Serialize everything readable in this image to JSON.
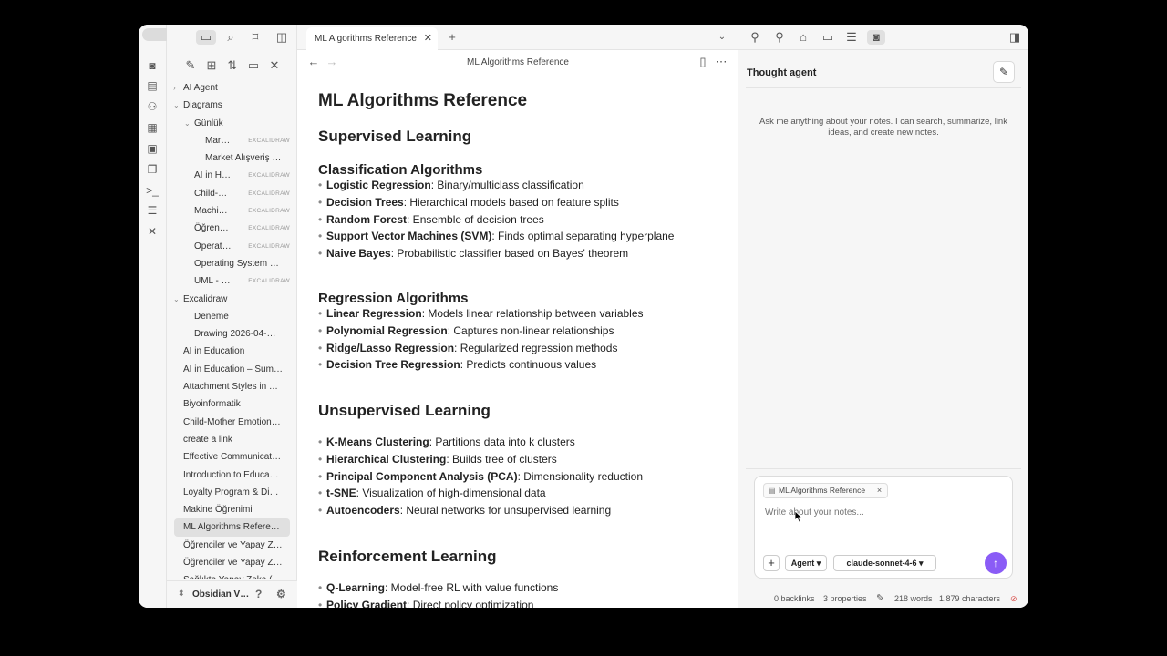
{
  "sidebar": {
    "tree": [
      {
        "label": "AI Agent",
        "level": 0,
        "chevron": "right"
      },
      {
        "label": "Diagrams",
        "level": 0,
        "chevron": "down"
      },
      {
        "label": "Günlük",
        "level": 1,
        "chevron": "down"
      },
      {
        "label": "Mar…",
        "level": 2,
        "tag": "EXCALIDRAW"
      },
      {
        "label": "Market Alışveriş …",
        "level": 2
      },
      {
        "label": "AI in H…",
        "level": 1,
        "tag": "EXCALIDRAW"
      },
      {
        "label": "Child-…",
        "level": 1,
        "tag": "EXCALIDRAW"
      },
      {
        "label": "Machi…",
        "level": 1,
        "tag": "EXCALIDRAW"
      },
      {
        "label": "Öğren…",
        "level": 1,
        "tag": "EXCALIDRAW"
      },
      {
        "label": "Operat…",
        "level": 1,
        "tag": "EXCALIDRAW"
      },
      {
        "label": "Operating System …",
        "level": 1
      },
      {
        "label": "UML - …",
        "level": 1,
        "tag": "EXCALIDRAW"
      },
      {
        "label": "Excalidraw",
        "level": 0,
        "chevron": "down"
      },
      {
        "label": "Deneme",
        "level": 1
      },
      {
        "label": "Drawing 2026-04-…",
        "level": 1
      },
      {
        "label": "AI in Education",
        "level": 0
      },
      {
        "label": "AI in Education – Sum…",
        "level": 0
      },
      {
        "label": "Attachment Styles in …",
        "level": 0
      },
      {
        "label": "Biyoinformatik",
        "level": 0
      },
      {
        "label": "Child-Mother Emotion…",
        "level": 0
      },
      {
        "label": "create a link",
        "level": 0
      },
      {
        "label": "Effective Communicat…",
        "level": 0
      },
      {
        "label": "Introduction to Educa…",
        "level": 0
      },
      {
        "label": "Loyalty Program & Di…",
        "level": 0
      },
      {
        "label": "Makine Öğrenimi",
        "level": 0
      },
      {
        "label": "ML Algorithms Refere…",
        "level": 0,
        "active": true
      },
      {
        "label": "Öğrenciler ve Yapay Z…",
        "level": 0
      },
      {
        "label": "Öğrenciler ve Yapay Z…",
        "level": 0
      },
      {
        "label": "Sağlıkta Yapay Zeka (…",
        "level": 0
      }
    ],
    "vault_name": "Obsidian V…"
  },
  "editor": {
    "tab_title": "ML Algorithms Reference",
    "nav_title": "ML Algorithms Reference",
    "doc": {
      "title": "ML Algorithms Reference",
      "s1": "Supervised Learning",
      "s1a": "Classification Algorithms",
      "s1a_items": [
        {
          "term": "Logistic Regression",
          "desc": ": Binary/multiclass classification"
        },
        {
          "term": "Decision Trees",
          "desc": ": Hierarchical models based on feature splits"
        },
        {
          "term": "Random Forest",
          "desc": ": Ensemble of decision trees"
        },
        {
          "term": "Support Vector Machines (SVM)",
          "desc": ": Finds optimal separating hyperplane"
        },
        {
          "term": "Naive Bayes",
          "desc": ": Probabilistic classifier based on Bayes' theorem"
        }
      ],
      "s1b": "Regression Algorithms",
      "s1b_items": [
        {
          "term": "Linear Regression",
          "desc": ": Models linear relationship between variables"
        },
        {
          "term": "Polynomial Regression",
          "desc": ": Captures non-linear relationships"
        },
        {
          "term": "Ridge/Lasso Regression",
          "desc": ": Regularized regression methods"
        },
        {
          "term": "Decision Tree Regression",
          "desc": ": Predicts continuous values"
        }
      ],
      "s2": "Unsupervised Learning",
      "s2_items": [
        {
          "term": "K-Means Clustering",
          "desc": ": Partitions data into k clusters"
        },
        {
          "term": "Hierarchical Clustering",
          "desc": ": Builds tree of clusters"
        },
        {
          "term": "Principal Component Analysis (PCA)",
          "desc": ": Dimensionality reduction"
        },
        {
          "term": "t-SNE",
          "desc": ": Visualization of high-dimensional data"
        },
        {
          "term": "Autoencoders",
          "desc": ": Neural networks for unsupervised learning"
        }
      ],
      "s3": "Reinforcement Learning",
      "s3_items": [
        {
          "term": "Q-Learning",
          "desc": ": Model-free RL with value functions"
        },
        {
          "term": "Policy Gradient",
          "desc": ": Direct policy optimization"
        }
      ]
    }
  },
  "agent": {
    "title": "Thought agent",
    "hint": "Ask me anything about your notes. I can search, summarize, link ideas, and create new notes.",
    "context_chip": "ML Algorithms Reference",
    "input_placeholder": "Write about your notes...",
    "mode": "Agent ▾",
    "model": "claude-sonnet-4-6 ▾",
    "send_color": "#8a5cf6"
  },
  "status": {
    "backlinks": "0 backlinks",
    "properties": "3 properties",
    "words": "218 words",
    "characters": "1,879 characters"
  }
}
